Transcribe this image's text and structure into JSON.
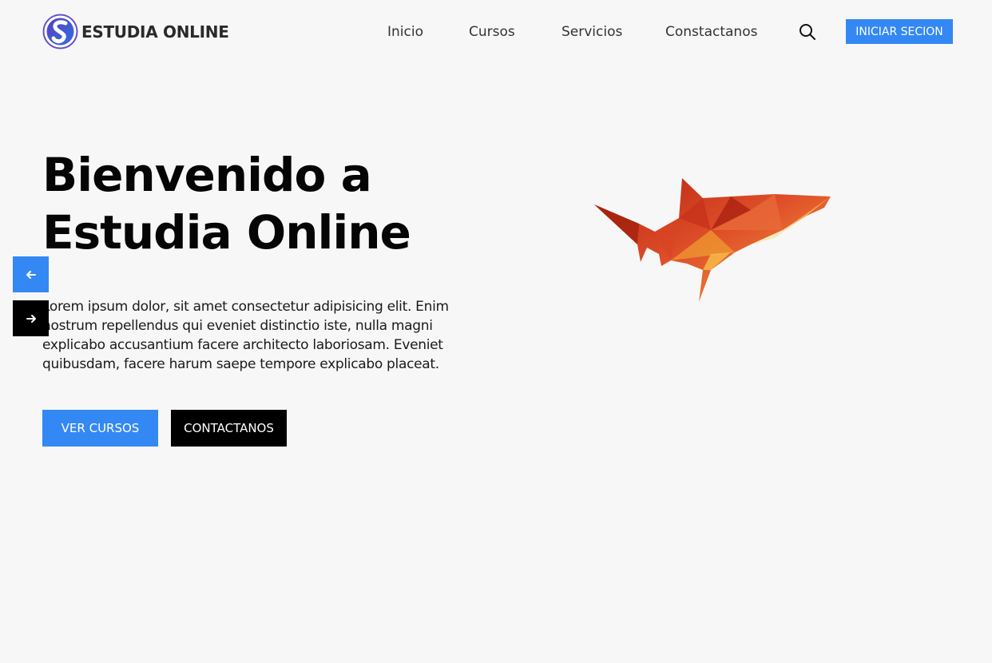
{
  "brand": {
    "name": "ESTUDIA ONLINE",
    "logo_icon": "s-logo-icon"
  },
  "nav": {
    "items": [
      {
        "label": "Inicio"
      },
      {
        "label": "Cursos"
      },
      {
        "label": "Servicios"
      },
      {
        "label": "Constactanos"
      }
    ],
    "search_icon": "search-icon",
    "login_label": "INICIAR SECION"
  },
  "hero": {
    "title_line1": "Bienvenido a",
    "title_line2": "Estudia Online",
    "text": "Lorem ipsum dolor, sit amet consectetur adipisicing elit. Enim nostrum repellendus qui eveniet distinctio iste, nulla magni explicabo accusantium facere architecto laboriosam. Eveniet quibusdam, facere harum saepe tempore explicabo placeat.",
    "primary_button": "VER CURSOS",
    "secondary_button": "CONTACTANOS",
    "image": "low-poly-shark-illustration"
  },
  "slider": {
    "prev_icon": "arrow-left-icon",
    "next_icon": "arrow-right-icon"
  },
  "colors": {
    "accent": "#3388f4",
    "dark": "#000000",
    "background": "#f7f7f7",
    "shark_red": "#c7321b",
    "shark_orange": "#f0a030"
  }
}
